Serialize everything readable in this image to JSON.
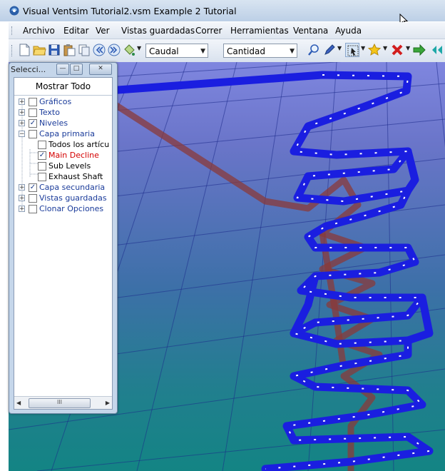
{
  "window": {
    "title": "Visual Ventsim   Tutorial2.vsm   Example 2 Tutorial"
  },
  "menu": {
    "items": [
      "Archivo",
      "Editar",
      "Ver",
      "Vistas guardadas",
      "Correr",
      "Herramientas",
      "Ventana",
      "Ayuda"
    ]
  },
  "toolbar": {
    "combo1": "Caudal",
    "combo2": "Cantidad"
  },
  "panel": {
    "title": "Selecci...",
    "show_all": "Mostrar Todo",
    "tree": [
      {
        "label": "Gráficos",
        "checked": false,
        "color": "#1a3b9a"
      },
      {
        "label": "Texto",
        "checked": false,
        "color": "#1a3b9a"
      },
      {
        "label": "Niveles",
        "checked": true,
        "color": "#1a3b9a"
      },
      {
        "label": "Capa primaria",
        "checked": false,
        "color": "#1a3b9a"
      },
      {
        "label": "Todos los artícu",
        "checked": false,
        "color": "#000000"
      },
      {
        "label": "Main Decline",
        "checked": true,
        "color": "#d40000"
      },
      {
        "label": "Sub Levels",
        "checked": false,
        "color": "#000000"
      },
      {
        "label": "Exhaust Shaft",
        "checked": false,
        "color": "#000000"
      },
      {
        "label": "Capa secundaria",
        "checked": true,
        "color": "#1a3b9a"
      },
      {
        "label": "Vistas guardadas",
        "checked": false,
        "color": "#1a3b9a"
      },
      {
        "label": "Clonar Opciones",
        "checked": false,
        "color": "#1a3b9a"
      }
    ],
    "scroll_thumb": "III"
  },
  "colors": {
    "airway_blue": "#1a1ee0",
    "decline_red": "#8a3a3a"
  }
}
